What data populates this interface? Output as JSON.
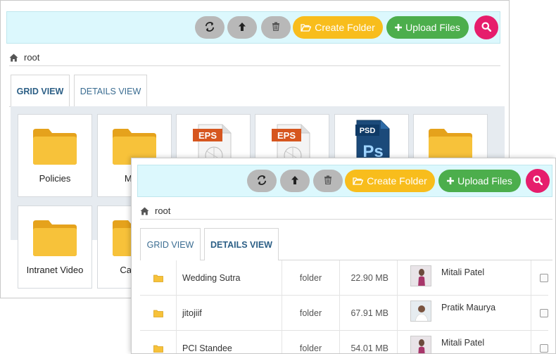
{
  "toolbar": {
    "create_folder": "Create Folder",
    "upload_files": "Upload Files"
  },
  "breadcrumb": {
    "root": "root"
  },
  "tabs": {
    "grid": "GRID VIEW",
    "details": "DETAILS VIEW"
  },
  "grid_items": [
    {
      "label": "Policies",
      "type": "folder"
    },
    {
      "label": "Medi",
      "type": "folder"
    },
    {
      "label": "",
      "type": "eps",
      "badge": "EPS"
    },
    {
      "label": "",
      "type": "eps",
      "badge": "EPS"
    },
    {
      "label": "",
      "type": "psd",
      "badge": "PSD"
    },
    {
      "label": "",
      "type": "folder"
    },
    {
      "label": "Intranet Video",
      "type": "folder"
    },
    {
      "label": "Capabi",
      "type": "folder"
    }
  ],
  "rows": [
    {
      "name": "Wedding Sutra",
      "type": "folder",
      "size": "22.90 MB",
      "owner": "Mitali Patel"
    },
    {
      "name": "jitojiif",
      "type": "folder",
      "size": "67.91 MB",
      "owner": "Pratik Maurya"
    },
    {
      "name": "PCI Standee",
      "type": "folder",
      "size": "54.01 MB",
      "owner": "Mitali Patel"
    }
  ],
  "colors": {
    "toolbar_bg": "#dcf8fd",
    "yellow": "#f8bd1c",
    "green": "#4cae4c",
    "pink": "#e61d6c",
    "grey_btn": "#b8b8b8",
    "folder": "#f2b630",
    "tab_text": "#2c5f86"
  }
}
